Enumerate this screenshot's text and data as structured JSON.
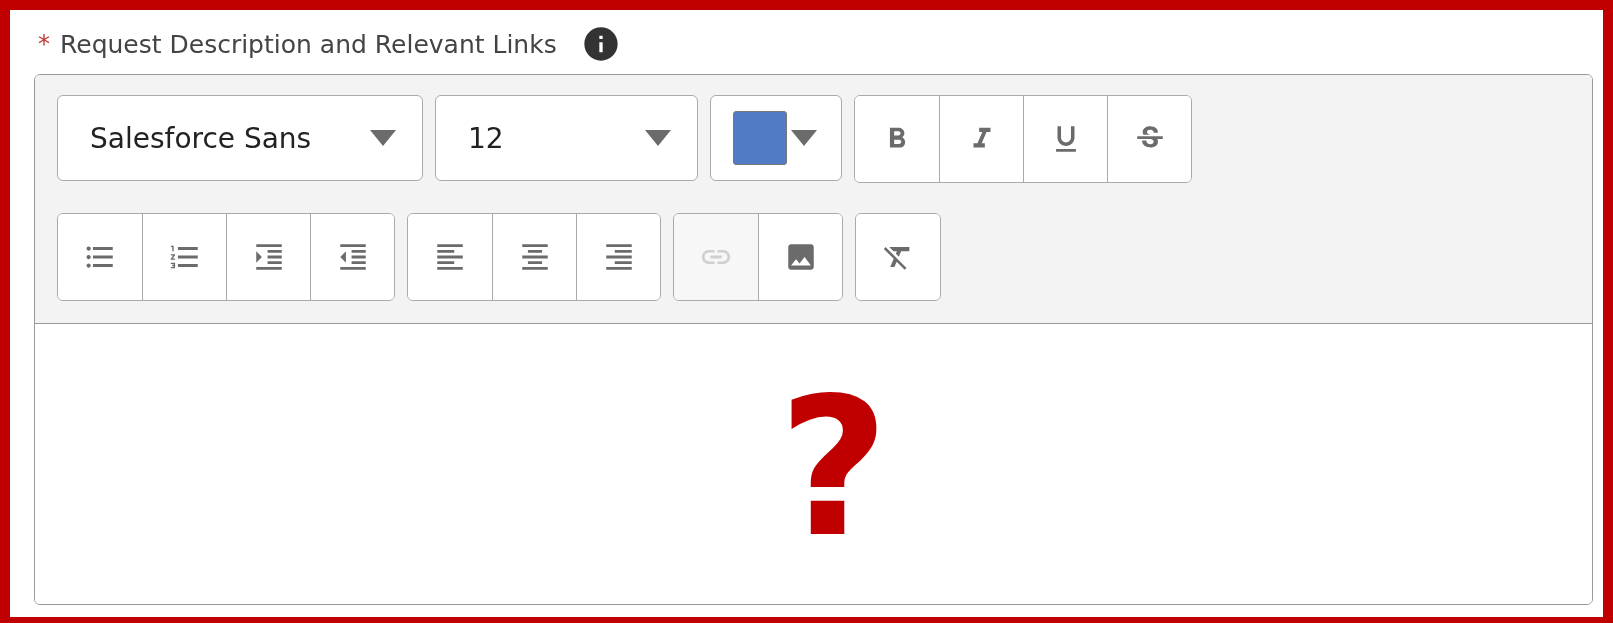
{
  "field": {
    "label": "Request Description and Relevant Links",
    "required": true,
    "required_mark": "*"
  },
  "toolbar": {
    "font": "Salesforce Sans",
    "size": "12",
    "text_color": {
      "color": "#517bc4"
    },
    "rows": [
      [
        {
          "buttons": [
            {
              "kind": "bold",
              "disabled": false
            },
            {
              "kind": "italic",
              "disabled": false
            },
            {
              "kind": "underline",
              "disabled": false
            },
            {
              "kind": "strike",
              "disabled": false
            }
          ]
        }
      ],
      [
        {
          "buttons": [
            {
              "kind": "bullets",
              "disabled": false
            },
            {
              "kind": "numbers",
              "disabled": false
            },
            {
              "kind": "indent",
              "disabled": false
            },
            {
              "kind": "outdent",
              "disabled": false
            }
          ]
        },
        {
          "buttons": [
            {
              "kind": "align-left",
              "disabled": false
            },
            {
              "kind": "align-center",
              "disabled": false
            },
            {
              "kind": "align-right",
              "disabled": false
            }
          ]
        },
        {
          "buttons": [
            {
              "kind": "link",
              "disabled": true
            },
            {
              "kind": "image",
              "disabled": false
            }
          ]
        },
        {
          "buttons": [
            {
              "kind": "clear",
              "disabled": false
            }
          ]
        }
      ]
    ]
  },
  "overlay": {
    "mark": "?"
  }
}
